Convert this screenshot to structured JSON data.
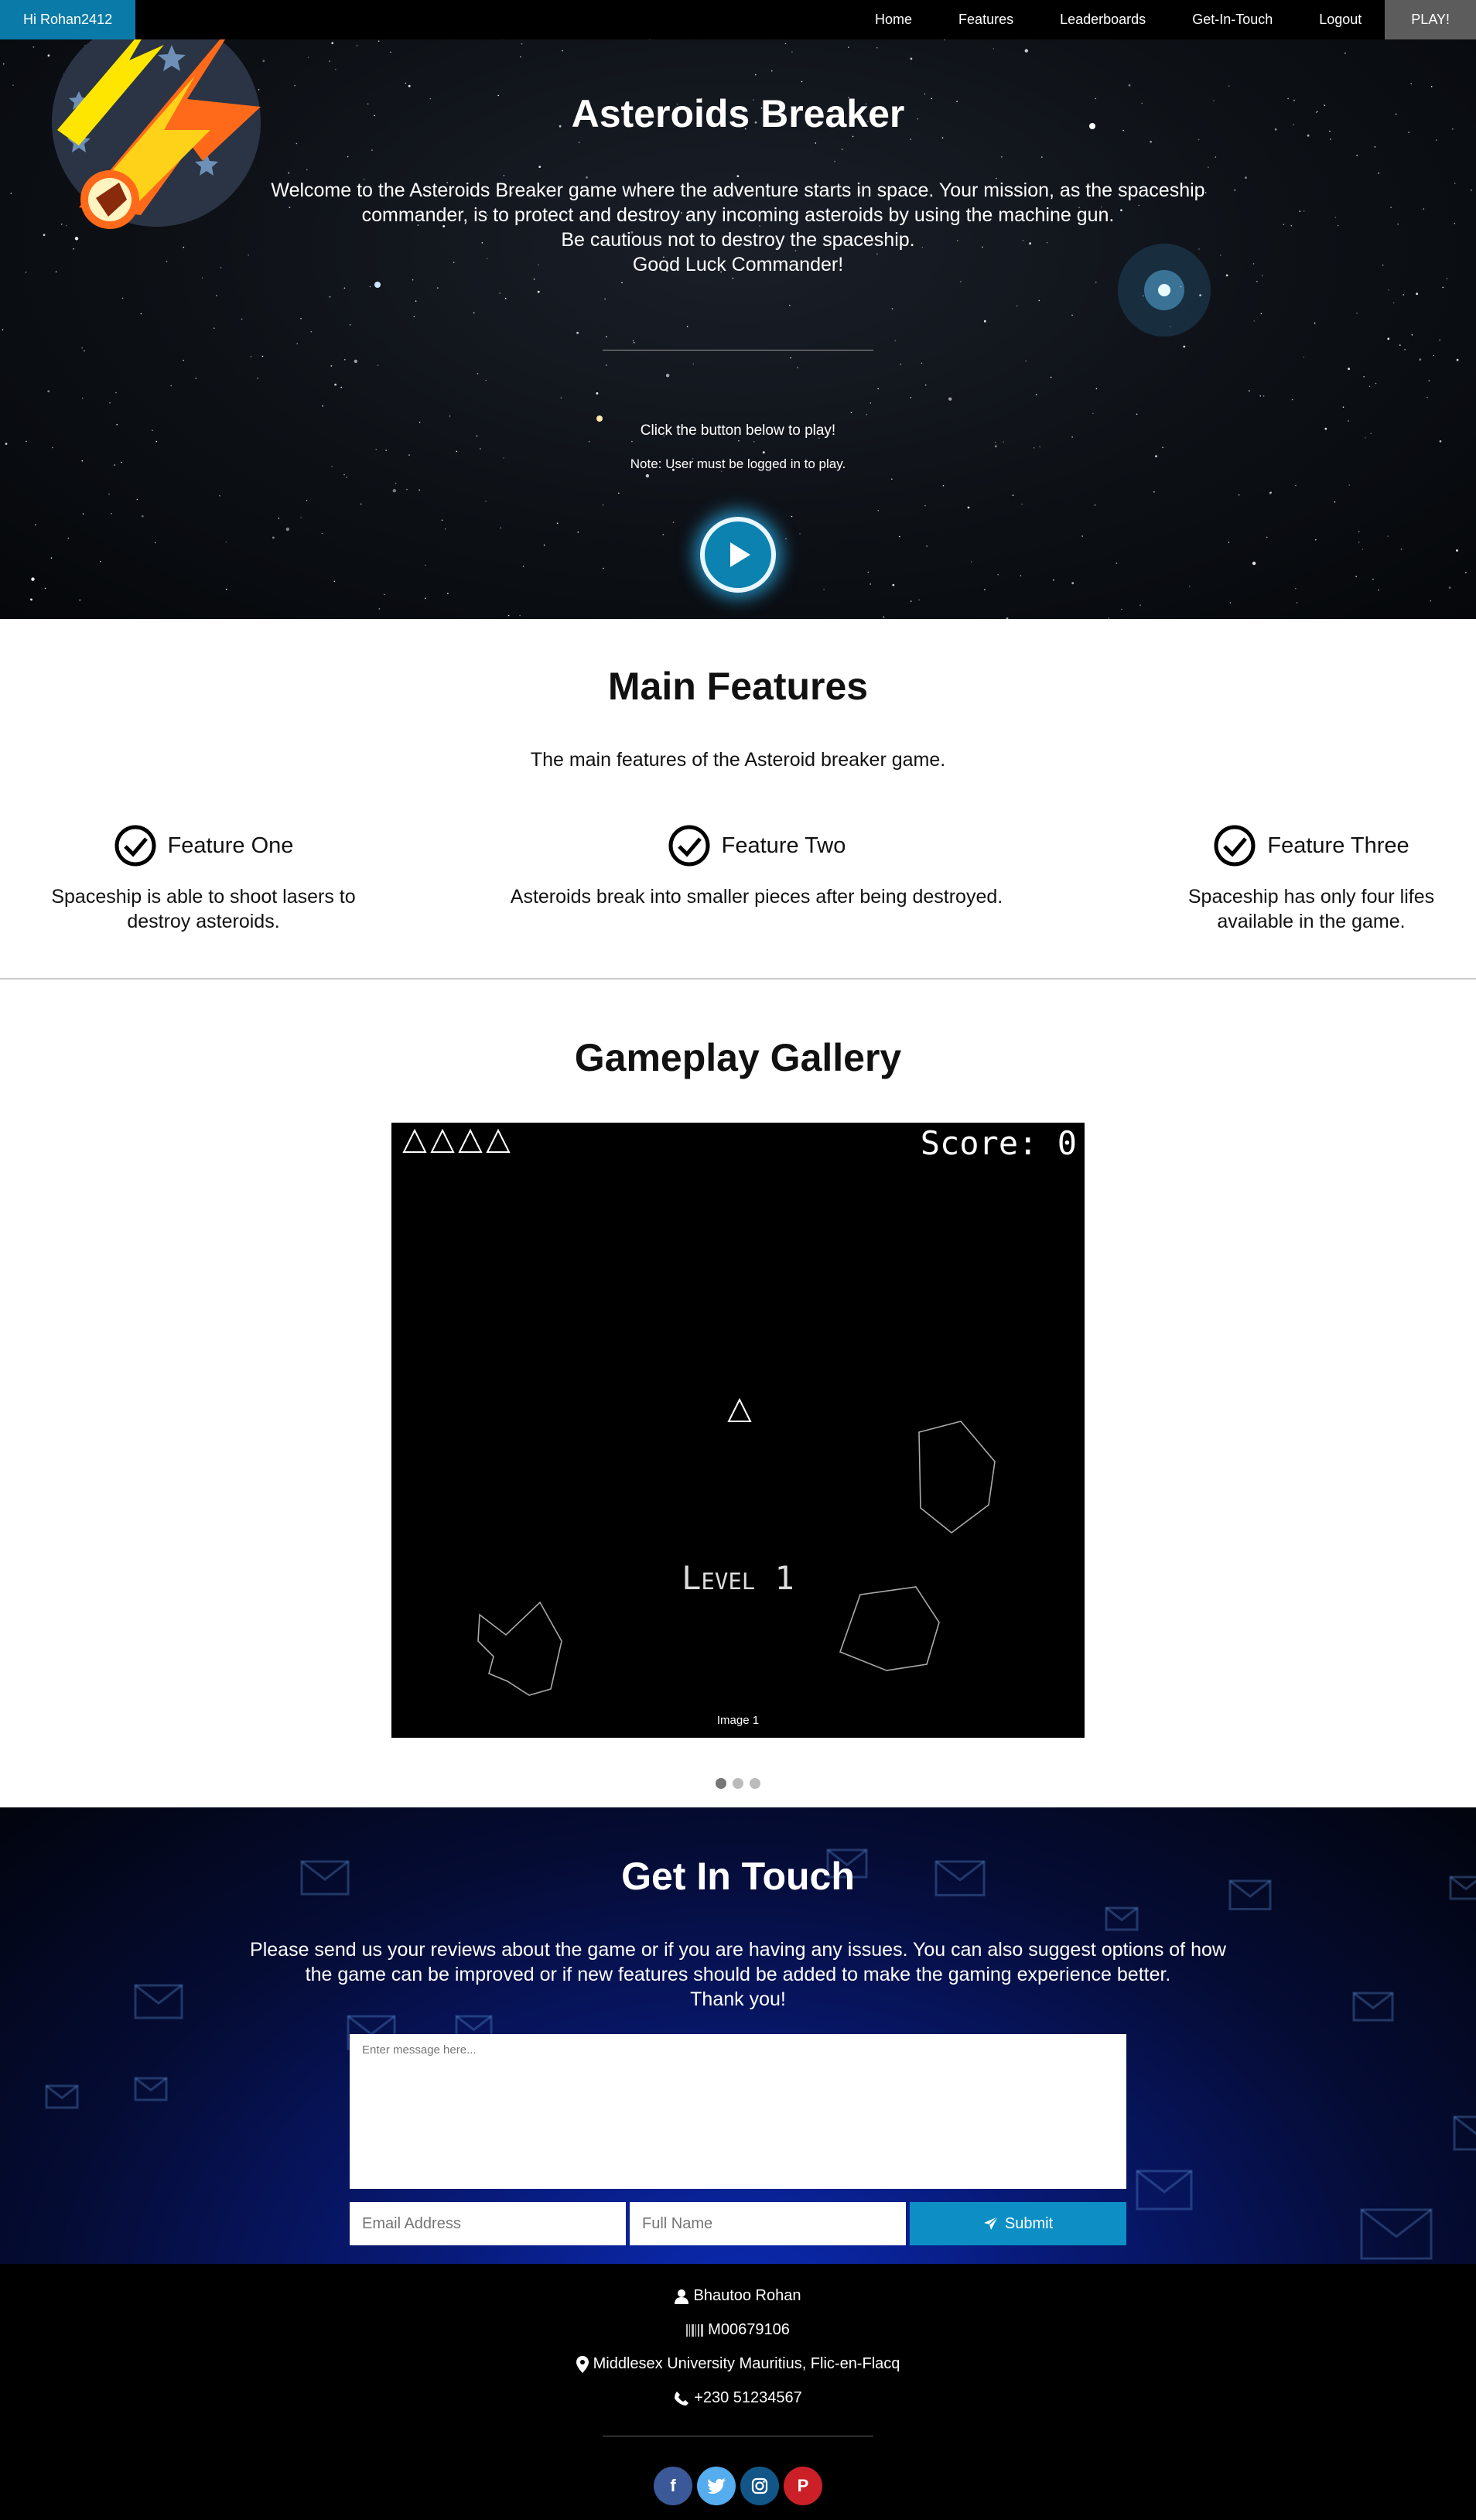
{
  "nav": {
    "user_label": "Hi Rohan2412",
    "links": [
      "Home",
      "Features",
      "Leaderboards",
      "Get-In-Touch",
      "Logout"
    ],
    "play_label": "PLAY!"
  },
  "hero": {
    "title": "Asteroids Breaker",
    "intro_lines": [
      "Welcome to the Asteroids Breaker game where the adventure starts in space. Your mission, as the spaceship",
      "commander, is to protect and destroy any incoming asteroids by using the machine gun.",
      "Be cautious not to destroy the spaceship.",
      "Good Luck Commander!"
    ],
    "click_text": "Click the button below to play!",
    "note_text": "Note: User must be logged in to play.",
    "play_icon": "play-icon"
  },
  "features": {
    "title": "Main Features",
    "subtitle": "The main features of the Asteroid breaker game.",
    "items": [
      {
        "title": "Feature One",
        "desc_lines": [
          "Spaceship is able to shoot lasers to",
          "destroy asteroids."
        ]
      },
      {
        "title": "Feature Two",
        "desc_lines": [
          "Asteroids break into smaller pieces after being destroyed."
        ]
      },
      {
        "title": "Feature Three",
        "desc_lines": [
          "Spaceship has only four lifes",
          "available in the game."
        ]
      }
    ],
    "icon": "check-circle-icon"
  },
  "gallery": {
    "title": "Gameplay Gallery",
    "score_text": "Score: 0",
    "level_text": "Level 1",
    "caption": "Image 1",
    "lives": 4,
    "slides": 3,
    "active_slide": 1
  },
  "contact": {
    "title": "Get In Touch",
    "message_lines": [
      "Please send us your reviews about the game or if you are having any issues. You can also suggest options of how",
      "the game can be improved or if new features should be added to make the gaming experience better.",
      "Thank you!"
    ],
    "message_placeholder": "Enter message here...",
    "email_placeholder": "Email Address",
    "name_placeholder": "Full Name",
    "submit_label": "Submit"
  },
  "footer": {
    "name": "Bhautoo Rohan",
    "student_id": "M00679106",
    "address": "Middlesex University Mauritius, Flic-en-Flacq",
    "phone": "+230 51234567",
    "social": [
      "facebook-icon",
      "twitter-icon",
      "instagram-icon",
      "pinterest-icon"
    ],
    "colors": {
      "facebook": "#3b5998",
      "twitter": "#55acee",
      "instagram": "#125688",
      "pinterest": "#cb2027"
    }
  },
  "colors": {
    "accent": "#0a7aa8",
    "play_bg": "#5c5c5c",
    "submit": "#0d8fc6"
  }
}
